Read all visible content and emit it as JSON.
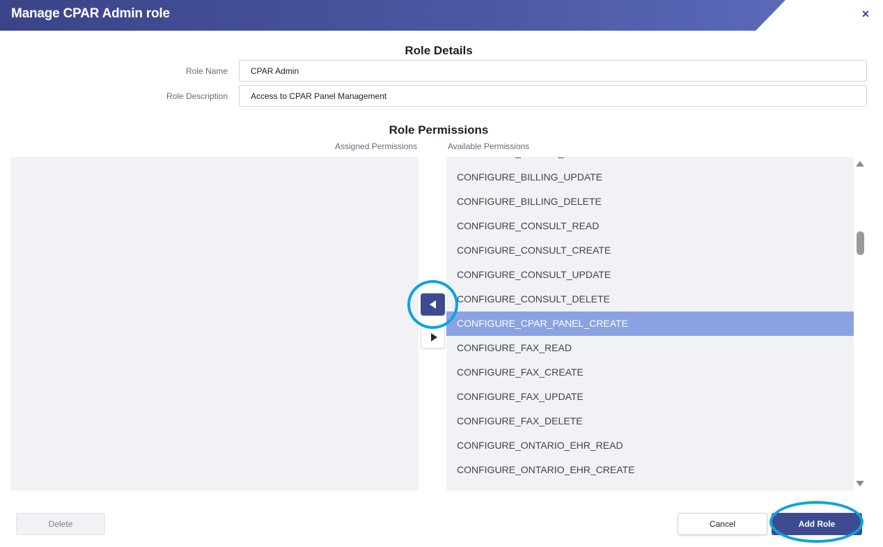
{
  "dialog": {
    "title": "Manage CPAR Admin role",
    "close_icon": "×"
  },
  "role_details": {
    "title": "Role Details",
    "role_name_label": "Role Name",
    "role_name_value": "CPAR Admin",
    "role_description_label": "Role Description",
    "role_description_value": "Access to CPAR Panel Management"
  },
  "role_permissions": {
    "title": "Role Permissions",
    "assigned_header": "Assigned Permissions",
    "available_header": "Available Permissions",
    "assigned_items": [],
    "available_items": [
      {
        "label": "CONFIGURE_BILLING_CREATE",
        "selected": false
      },
      {
        "label": "CONFIGURE_BILLING_UPDATE",
        "selected": false
      },
      {
        "label": "CONFIGURE_BILLING_DELETE",
        "selected": false
      },
      {
        "label": "CONFIGURE_CONSULT_READ",
        "selected": false
      },
      {
        "label": "CONFIGURE_CONSULT_CREATE",
        "selected": false
      },
      {
        "label": "CONFIGURE_CONSULT_UPDATE",
        "selected": false
      },
      {
        "label": "CONFIGURE_CONSULT_DELETE",
        "selected": false
      },
      {
        "label": "CONFIGURE_CPAR_PANEL_CREATE",
        "selected": true
      },
      {
        "label": "CONFIGURE_FAX_READ",
        "selected": false
      },
      {
        "label": "CONFIGURE_FAX_CREATE",
        "selected": false
      },
      {
        "label": "CONFIGURE_FAX_UPDATE",
        "selected": false
      },
      {
        "label": "CONFIGURE_FAX_DELETE",
        "selected": false
      },
      {
        "label": "CONFIGURE_ONTARIO_EHR_READ",
        "selected": false
      },
      {
        "label": "CONFIGURE_ONTARIO_EHR_CREATE",
        "selected": false
      }
    ],
    "move_left_icon": "caret-left-icon",
    "move_right_icon": "caret-right-icon"
  },
  "buttons": {
    "delete": "Delete",
    "cancel": "Cancel",
    "add_role": "Add Role"
  },
  "colors": {
    "header": "#3b4487",
    "accent": "#3f4b90",
    "selected_row": "#8ba2e2",
    "highlight_ring": "#0ea3e0",
    "list_background": "#f1f2f6"
  }
}
